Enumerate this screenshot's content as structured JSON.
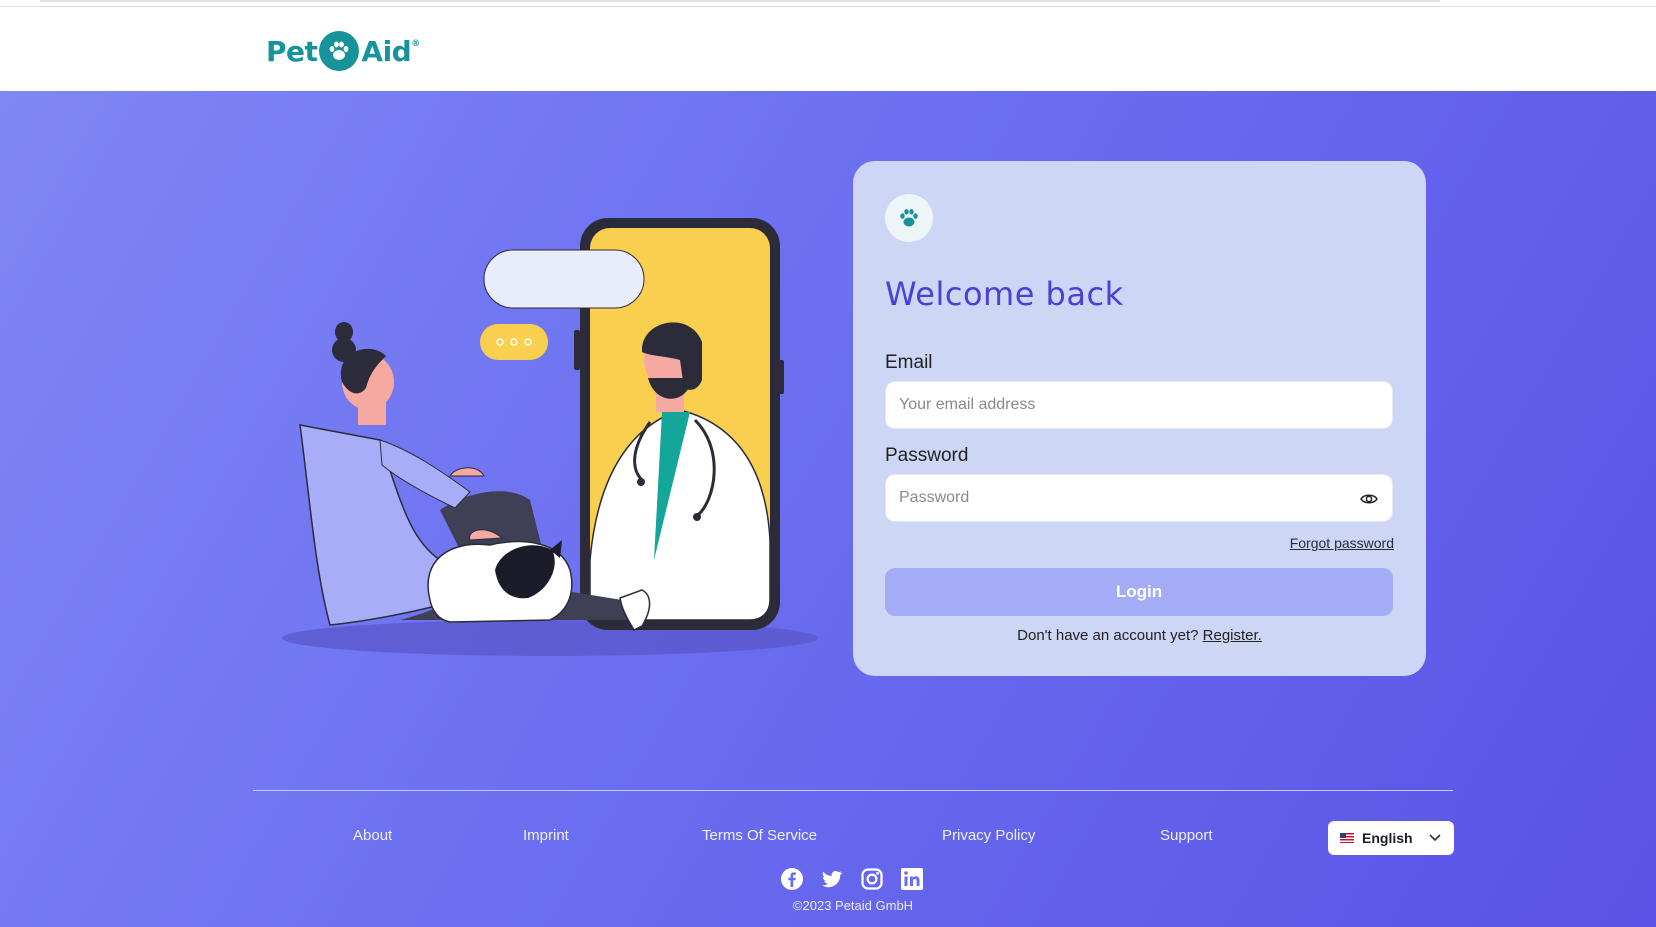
{
  "header": {
    "logo_left": "Pet",
    "logo_right": "Aid",
    "logo_mark": "®"
  },
  "login": {
    "title": "Welcome back",
    "email_label": "Email",
    "email_placeholder": "Your email address",
    "password_label": "Password",
    "password_placeholder": "Password",
    "forgot_label": "Forgot password",
    "login_label": "Login",
    "no_account_text": "Don't have an account yet?",
    "register_label": "Register."
  },
  "footer": {
    "links": [
      "About",
      "Imprint",
      "Terms Of Service",
      "Privacy Policy",
      "Support"
    ],
    "language": "English",
    "socials": [
      "facebook-icon",
      "twitter-icon",
      "instagram-icon",
      "linkedin-icon"
    ],
    "copyright": "©2023 Petaid GmbH"
  },
  "colors": {
    "brand": "#16939b",
    "accent": "#4a3fd6",
    "login_button": "#a4acf7",
    "hero_start": "#7f86f5",
    "hero_end": "#5a52e6"
  }
}
